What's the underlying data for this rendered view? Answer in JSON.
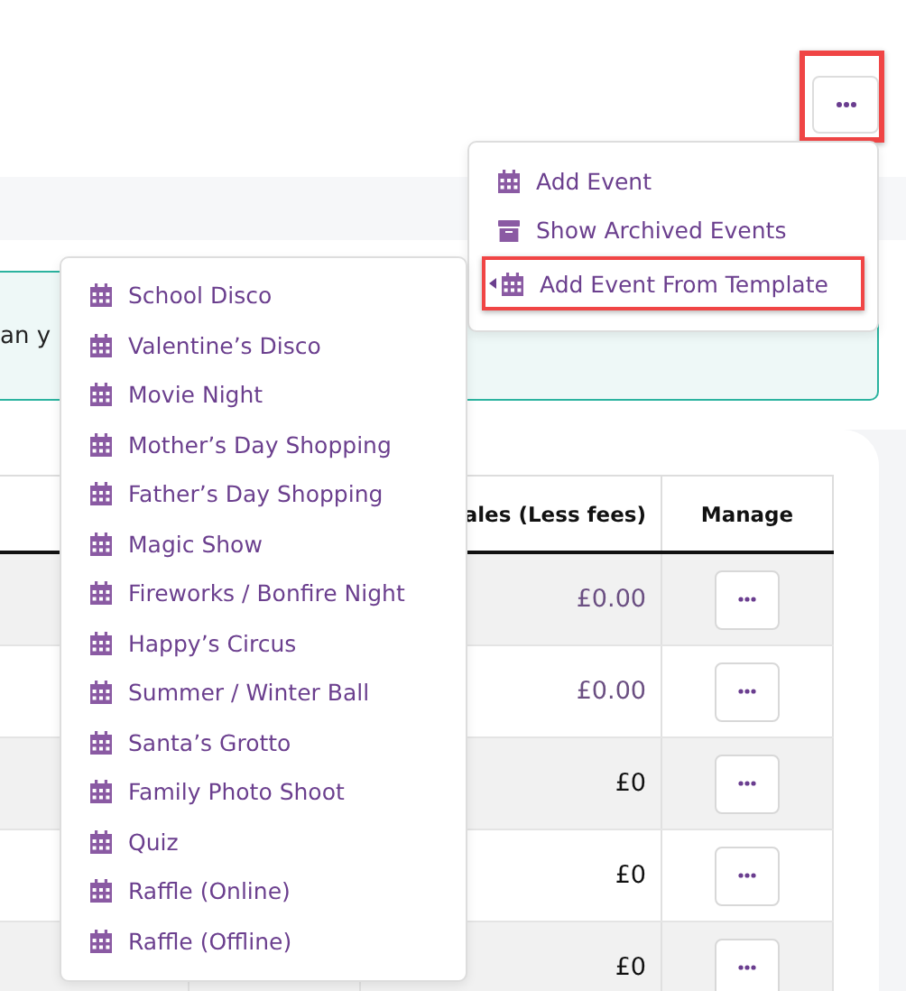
{
  "menu_button": {
    "highlighted": true
  },
  "actions_menu": {
    "items": [
      {
        "kind": "calendar",
        "label": "Add Event",
        "highlighted": false,
        "has_submenu": false
      },
      {
        "kind": "archive",
        "label": "Show Archived Events",
        "highlighted": false,
        "has_submenu": false
      },
      {
        "kind": "calendar",
        "label": "Add Event From Template",
        "highlighted": true,
        "has_submenu": true
      }
    ]
  },
  "alert": {
    "text": "an y"
  },
  "table": {
    "columns": [
      "ales (Less fees)",
      "Manage"
    ],
    "rows": [
      {
        "sales": "£0.00",
        "dimmed": true
      },
      {
        "sales": "£0.00",
        "dimmed": true
      },
      {
        "sales": "£0",
        "dimmed": false
      },
      {
        "sales": "£0",
        "dimmed": false
      },
      {
        "sales": "£0",
        "dimmed": false
      }
    ]
  },
  "template_menu": {
    "items": [
      "School Disco",
      "Valentine’s Disco",
      "Movie Night",
      "Mother’s Day Shopping",
      "Father’s Day Shopping",
      "Magic Show",
      "Fireworks / Bonfire Night",
      "Happy’s Circus",
      "Summer / Winter Ball",
      "Santa’s Grotto",
      "Family Photo Shoot",
      "Quiz",
      "Raffle (Online)",
      "Raffle (Offline)"
    ]
  }
}
